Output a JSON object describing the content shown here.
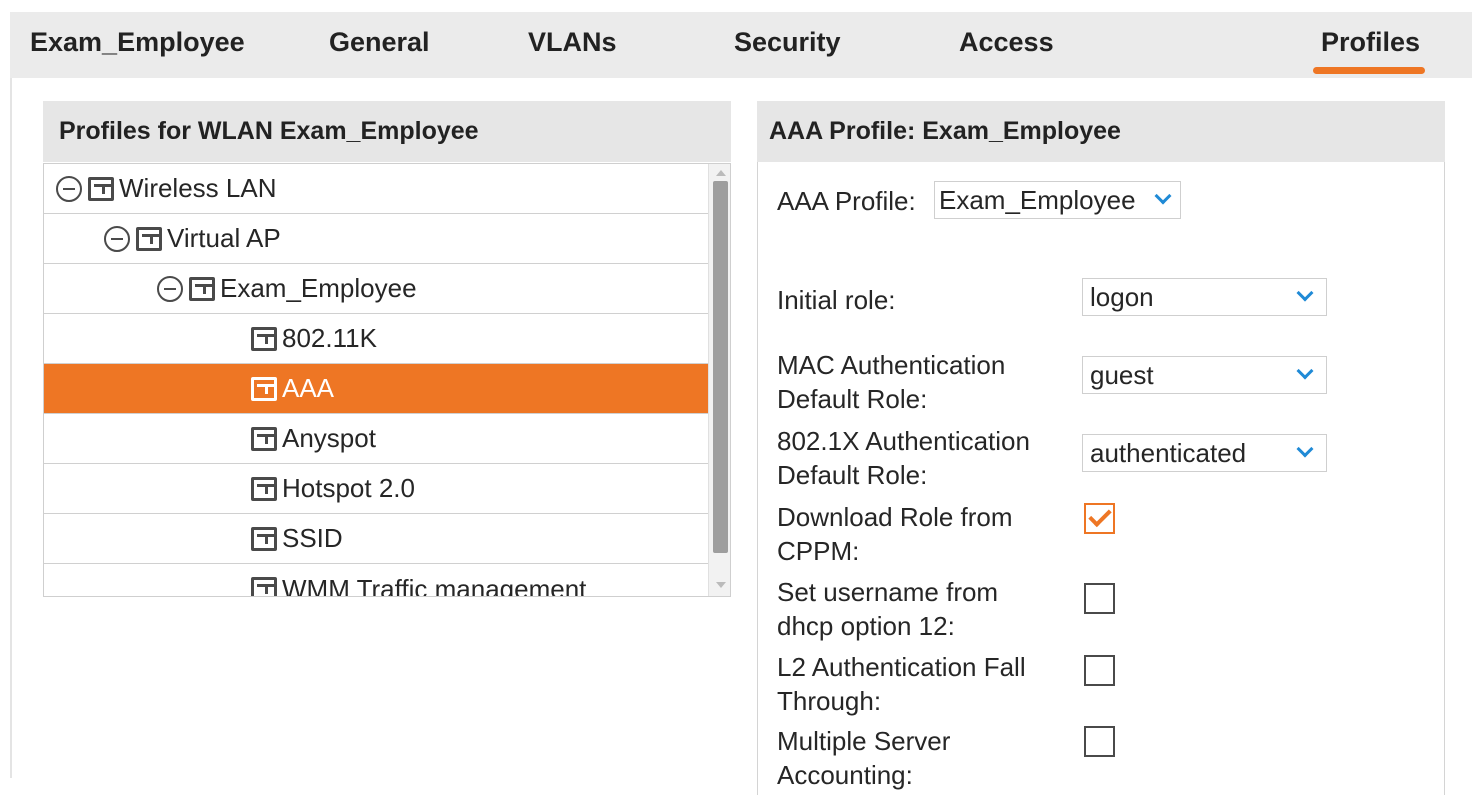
{
  "tabs": [
    {
      "label": "Exam_Employee"
    },
    {
      "label": "General"
    },
    {
      "label": "VLANs"
    },
    {
      "label": "Security"
    },
    {
      "label": "Access"
    },
    {
      "label": "Profiles",
      "active": true
    }
  ],
  "left_panel": {
    "title": "Profiles for WLAN Exam_Employee",
    "tree": [
      {
        "label": "Wireless LAN",
        "level": 0,
        "expandable": true,
        "icon": "profile-icon"
      },
      {
        "label": "Virtual AP",
        "level": 1,
        "expandable": true,
        "icon": "profile-icon"
      },
      {
        "label": "Exam_Employee",
        "level": 2,
        "expandable": true,
        "icon": "profile-icon"
      },
      {
        "label": "802.11K",
        "level": 3,
        "expandable": false,
        "icon": "profile-icon"
      },
      {
        "label": "AAA",
        "level": 3,
        "expandable": false,
        "selected": true,
        "icon": "profile-icon"
      },
      {
        "label": "Anyspot",
        "level": 3,
        "expandable": false,
        "icon": "profile-icon"
      },
      {
        "label": "Hotspot 2.0",
        "level": 3,
        "expandable": false,
        "icon": "profile-icon"
      },
      {
        "label": "SSID",
        "level": 3,
        "expandable": false,
        "icon": "profile-icon"
      },
      {
        "label": "WMM Traffic management",
        "level": 3,
        "expandable": false,
        "icon": "profile-icon"
      }
    ]
  },
  "right_panel": {
    "title": "AAA Profile: Exam_Employee",
    "aaa_profile_label": "AAA Profile:",
    "aaa_profile_value": "Exam_Employee",
    "initial_role_label": "Initial role:",
    "initial_role_value": "logon",
    "mac_role_label_1": "MAC Authentication",
    "mac_role_label_2": "Default Role:",
    "mac_role_value": "guest",
    "dot1x_role_label_1": "802.1X Authentication",
    "dot1x_role_label_2": "Default Role:",
    "dot1x_role_value": "authenticated",
    "download_role_label_1": "Download Role from",
    "download_role_label_2": "CPPM:",
    "download_role_checked": true,
    "dhcp_opt12_label_1": "Set username from",
    "dhcp_opt12_label_2": "dhcp option 12:",
    "dhcp_opt12_checked": false,
    "l2_fallthrough_label_1": "L2 Authentication Fall",
    "l2_fallthrough_label_2": "Through:",
    "l2_fallthrough_checked": false,
    "multi_server_label_1": "Multiple Server",
    "multi_server_label_2": "Accounting:",
    "multi_server_checked": false
  },
  "colors": {
    "accent": "#ee7624",
    "chevron": "#1f8ad6",
    "header_bg": "#e6e6e6"
  }
}
